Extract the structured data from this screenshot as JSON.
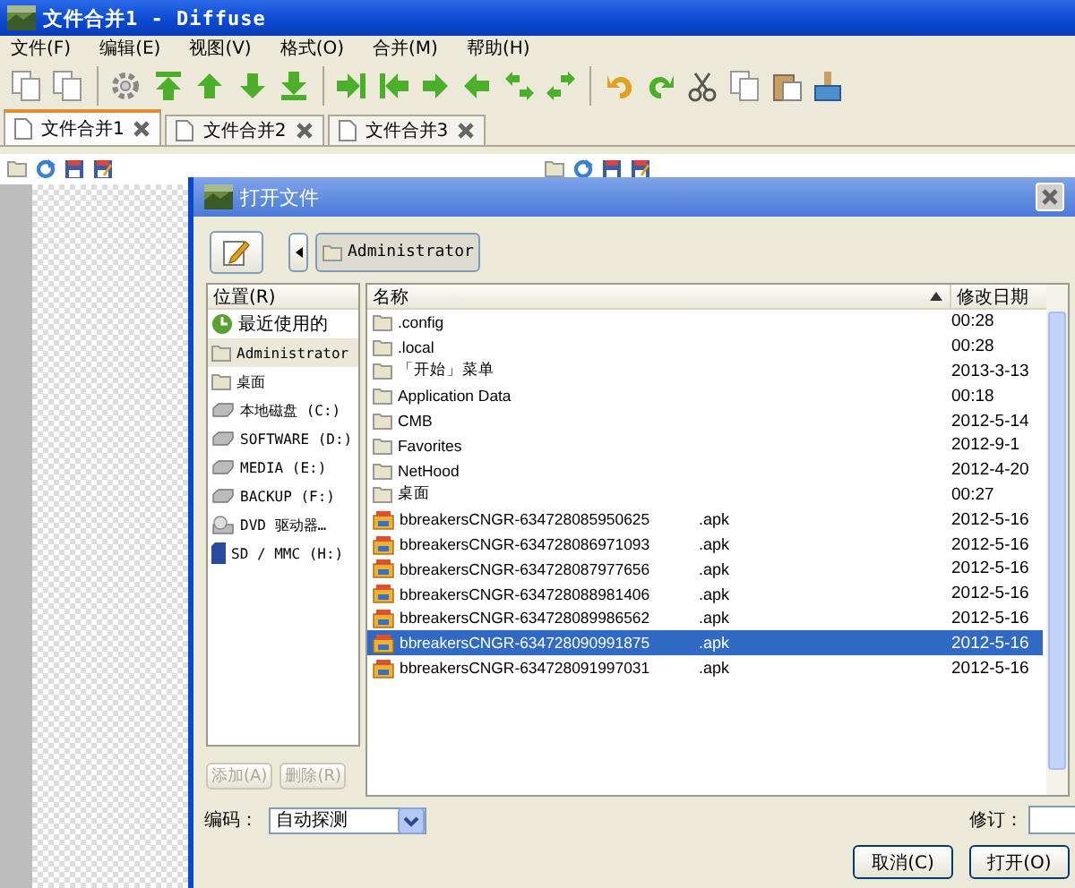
{
  "window": {
    "title": "文件合并1 - Diffuse"
  },
  "menu": [
    "文件(F)",
    "编辑(E)",
    "视图(V)",
    "格式(O)",
    "合并(M)",
    "帮助(H)"
  ],
  "tabs": [
    {
      "label": "文件合并1",
      "selected": true
    },
    {
      "label": "文件合并2",
      "selected": false
    },
    {
      "label": "文件合并3",
      "selected": false
    }
  ],
  "dialog": {
    "title": "打开文件",
    "path_button": "Administrator",
    "places_header": "位置(R)",
    "places": [
      {
        "label": "最近使用的",
        "kind": "recent",
        "selected": false
      },
      {
        "label": "Administrator",
        "kind": "folder",
        "selected": true
      },
      {
        "label": "桌面",
        "kind": "folder",
        "selected": false
      },
      {
        "label": "本地磁盘 (C:)",
        "kind": "drive",
        "selected": false
      },
      {
        "label": "SOFTWARE (D:)",
        "kind": "drive",
        "selected": false
      },
      {
        "label": "MEDIA (E:)",
        "kind": "drive",
        "selected": false
      },
      {
        "label": "BACKUP (F:)",
        "kind": "drive",
        "selected": false
      },
      {
        "label": "DVD 驱动器…",
        "kind": "dvd",
        "selected": false
      },
      {
        "label": "SD / MMC (H:)",
        "kind": "card",
        "selected": false
      }
    ],
    "add_button": {
      "label": "添加(A)",
      "disabled": true
    },
    "remove_button": {
      "label": "删除(R)",
      "disabled": true
    },
    "columns": {
      "name": "名称",
      "modified": "修改日期"
    },
    "files": [
      {
        "name": ".config",
        "kind": "folder",
        "modified": "00:28",
        "selected": false
      },
      {
        "name": ".local",
        "kind": "folder",
        "modified": "00:28",
        "selected": false
      },
      {
        "name": "「开始」菜单",
        "kind": "folder",
        "modified": "2013-3-13",
        "selected": false
      },
      {
        "name": "Application Data",
        "kind": "folder",
        "modified": "00:18",
        "selected": false
      },
      {
        "name": "CMB",
        "kind": "folder",
        "modified": "2012-5-14",
        "selected": false
      },
      {
        "name": "Favorites",
        "kind": "folder",
        "modified": "2012-9-1",
        "selected": false
      },
      {
        "name": "NetHood",
        "kind": "folder",
        "modified": "2012-4-20",
        "selected": false
      },
      {
        "name": "桌面",
        "kind": "folder",
        "modified": "00:27",
        "selected": false
      },
      {
        "name": "bbreakersCNGR-634728085950625",
        "ext": ".apk",
        "kind": "package",
        "modified": "2012-5-16",
        "selected": false
      },
      {
        "name": "bbreakersCNGR-634728086971093",
        "ext": ".apk",
        "kind": "package",
        "modified": "2012-5-16",
        "selected": false
      },
      {
        "name": "bbreakersCNGR-634728087977656",
        "ext": ".apk",
        "kind": "package",
        "modified": "2012-5-16",
        "selected": false
      },
      {
        "name": "bbreakersCNGR-634728088981406",
        "ext": ".apk",
        "kind": "package",
        "modified": "2012-5-16",
        "selected": false
      },
      {
        "name": "bbreakersCNGR-634728089986562",
        "ext": ".apk",
        "kind": "package",
        "modified": "2012-5-16",
        "selected": false
      },
      {
        "name": "bbreakersCNGR-634728090991875",
        "ext": ".apk",
        "kind": "package",
        "modified": "2012-5-16",
        "selected": true
      },
      {
        "name": "bbreakersCNGR-634728091997031",
        "ext": ".apk",
        "kind": "package",
        "modified": "2012-5-16",
        "selected": false
      }
    ],
    "encoding_label": "编码：",
    "encoding_value": "自动探测",
    "revision_label": "修订：",
    "cancel_button": "取消(C)",
    "open_button": "打开(O)"
  }
}
